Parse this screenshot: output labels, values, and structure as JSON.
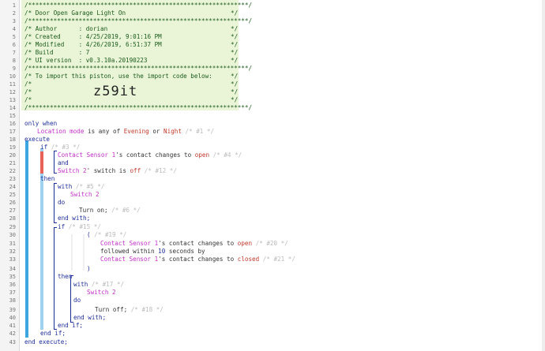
{
  "line_numbers": [
    "1",
    "2",
    "3",
    "4",
    "5",
    "6",
    "7",
    "8",
    "9",
    "10",
    "11",
    "12",
    "13",
    "14",
    "15",
    "16",
    "17",
    "18",
    "19",
    "20",
    "21",
    "22",
    "23",
    "24",
    "25",
    "26",
    "27",
    "28",
    "29",
    "30",
    "31",
    "32",
    "33",
    "34",
    "35",
    "36",
    "37",
    "38",
    "39",
    "40",
    "41",
    "42",
    "43"
  ],
  "header": {
    "l1": "/*************************************************************/",
    "l2a": "/* Door Open Garage Light On",
    "l2b": "*/",
    "l3": "/*************************************************************/",
    "l4a": "/* Author      : dorian",
    "l4b": "*/",
    "l5a": "/* Created     : 4/25/2019, 9:01:16 PM",
    "l5b": "*/",
    "l6a": "/* Modified    : 4/26/2019, 6:51:37 PM",
    "l6b": "*/",
    "l7a": "/* Build       : 7",
    "l7b": "*/",
    "l8a": "/* UI version  : v0.3.10a.20190223",
    "l8b": "*/",
    "l9": "/*************************************************************/",
    "l10a": "/* To import this piston, use the import code below:",
    "l10b": "*/",
    "l11a": "/*",
    "l11b": "*/",
    "l12a": "/*",
    "l12b": "*/",
    "l13a": "/*",
    "l13b": "*/",
    "l14": "/*************************************************************/",
    "import_code": "z59it"
  },
  "code": {
    "only_when": "only when",
    "loc_a": "Location mode",
    "loc_b": " is any of ",
    "loc_c": "Evening",
    "loc_d": " or ",
    "loc_e": "Night",
    "loc_id": " /* #1 */",
    "execute": "execute",
    "if1": "if",
    "if1_id": " /* #3 */",
    "c1_dev": "Contact Sensor 1",
    "c1_s": "'s ",
    "c1_attr": "contact",
    "c1_op": " changes to ",
    "c1_val": "open",
    "c1_id": " /* #4 */",
    "and": "and",
    "c2_dev": "Switch 2",
    "c2_s": "' ",
    "c2_attr": "switch",
    "c2_op": " is ",
    "c2_val": "off",
    "c2_id": " /* #12 */",
    "then1": "then",
    "with1": "with",
    "with1_id": " /* #5 */",
    "sw2a": "Switch 2",
    "do1": "do",
    "turn_on": "Turn on;",
    "turn_on_id": " /* #6 */",
    "endwith1": "end with;",
    "if2": "if",
    "if2_id": " /* #15 */",
    "paren_open": "(",
    "paren_id": " /* #19 */",
    "c3_dev": "Contact Sensor 1",
    "c3_s": "'s ",
    "c3_attr": "contact",
    "c3_op": " changes to ",
    "c3_val": "open",
    "c3_id": " /* #20 */",
    "followed_a": "followed within ",
    "followed_b": "10",
    "followed_c": " seconds by",
    "c4_dev": "Contact Sensor 1",
    "c4_s": "'s ",
    "c4_attr": "contact",
    "c4_op": " changes to ",
    "c4_val": "closed",
    "c4_id": " /* #21 */",
    "paren_close": ")",
    "then2": "then",
    "with2": "with",
    "with2_id": " /* #17 */",
    "sw2b": "Switch 2",
    "do2": "do",
    "turn_off": "Turn off;",
    "turn_off_id": " /* #18 */",
    "endwith2": "end with;",
    "endif2": "end if;",
    "endif1": "end if;",
    "endexecute": "end execute;"
  },
  "colors": {
    "comment_bg": "#eaf5d8",
    "keyword": "#1f2f9a",
    "device": "#c02fc6",
    "value": "#c0392b",
    "restriction_bar": "#e8625a",
    "execute_bar": "#3da5e0"
  }
}
